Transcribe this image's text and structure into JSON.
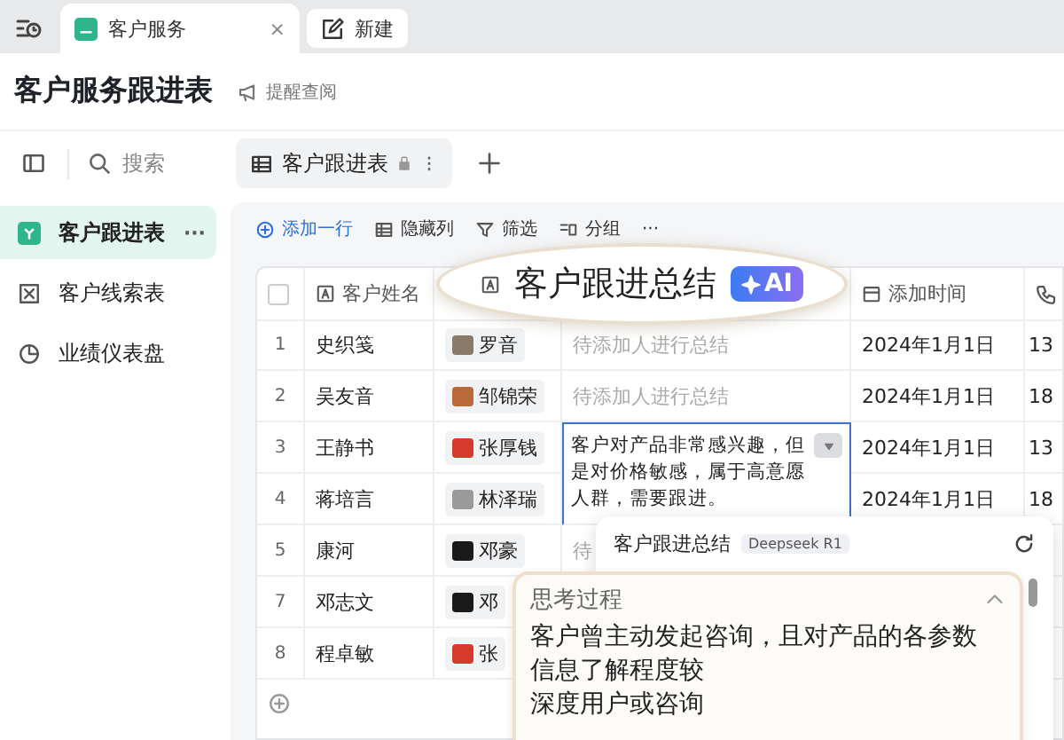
{
  "tabs": [
    {
      "label": "客户服务",
      "selected": true,
      "kind": "doc",
      "close": "×"
    },
    {
      "label": "新建",
      "selected": false,
      "kind": "new"
    }
  ],
  "page": {
    "title": "客户服务跟进表",
    "remind": "提醒查阅"
  },
  "sidebar": {
    "search": {
      "placeholder": "搜索"
    },
    "items": [
      {
        "label": "客户跟进表",
        "selected": true,
        "kind": "table",
        "more": "···"
      },
      {
        "label": "客户线索表",
        "selected": false,
        "kind": "form"
      },
      {
        "label": "业绩仪表盘",
        "selected": false,
        "kind": "dashboard"
      }
    ]
  },
  "view_tab": {
    "label": "客户跟进表",
    "locked": true
  },
  "toolbar": [
    {
      "label": "添加一行",
      "kind": "add"
    },
    {
      "label": "隐藏列",
      "kind": "columns"
    },
    {
      "label": "筛选",
      "kind": "filter"
    },
    {
      "label": "分组",
      "kind": "group"
    },
    {
      "label": "···",
      "kind": "more"
    }
  ],
  "table": {
    "select_all": {
      "checked": false
    },
    "columns": [
      {
        "kind": "check"
      },
      {
        "label": "客户姓名",
        "kind": "text"
      },
      {
        "kind": "person"
      },
      {
        "kind": "ai"
      },
      {
        "label": "添加时间",
        "kind": "date"
      },
      {
        "kind": "phone"
      }
    ],
    "rows": [
      {
        "number": "1",
        "name": "史织笺",
        "owner": "罗音",
        "color": "#8a7a6a",
        "summary_placeholder": "待添加人进行总结",
        "date": "2024年1月1日",
        "phone": "13"
      },
      {
        "number": "2",
        "name": "吴友音",
        "owner": "邹锦荣",
        "color": "#b86a3a",
        "summary_placeholder": "待添加人进行总结",
        "date": "2024年1月1日",
        "phone": "18"
      },
      {
        "number": "3",
        "name": "王静书",
        "owner": "张厚钱",
        "color": "#d63a2a",
        "summary": "客户对产品非常感兴趣，但是对价格敏感，属于高意愿人群，需要跟进。",
        "merged_with_next": true,
        "date": "2024年1月1日",
        "phone": "13"
      },
      {
        "number": "4",
        "name": "蒋培言",
        "owner": "林泽瑞",
        "color": "#9a9a9a",
        "date": "2024年1月1日",
        "phone": "18"
      },
      {
        "number": "5",
        "name": "康河",
        "owner": "邓豪",
        "color": "#1a1a1a",
        "summary_placeholder": "待"
      },
      {
        "number": "7",
        "name": "邓志文",
        "owner": "邓",
        "color": "#1a1a1a"
      },
      {
        "number": "8",
        "name": "程卓敏",
        "owner": "张",
        "color": "#d63a2a"
      }
    ]
  },
  "callout": {
    "label": "客户跟进总结",
    "badge": "AI"
  },
  "popup": {
    "title": "客户跟进总结",
    "model": "Deepseek R1",
    "thinking": {
      "label": "思考过程",
      "expanded": true,
      "lines": [
        "客户曾主动发起咨询，且对产品的各参数",
        "信息了解程度较",
        "深度用户或咨询"
      ]
    }
  }
}
